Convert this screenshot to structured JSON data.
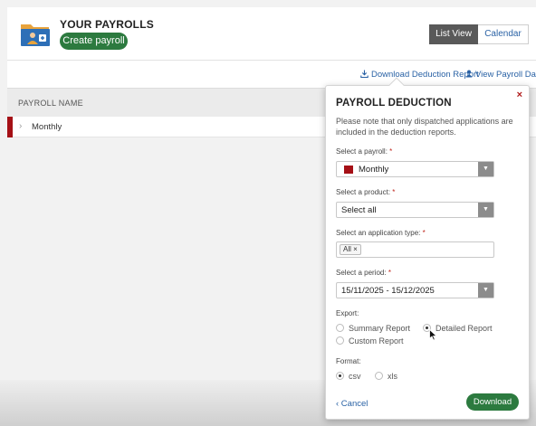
{
  "header": {
    "title": "YOUR PAYROLLS",
    "create_label": "Create payroll",
    "view_toggle": {
      "list": "List View",
      "calendar": "Calendar",
      "active": "List View"
    }
  },
  "links": {
    "download": "Download Deduction Report",
    "view_data": "View Payroll Data"
  },
  "table": {
    "column_header": "PAYROLL NAME",
    "rows": [
      {
        "chevron": "›",
        "name": "Monthly"
      }
    ]
  },
  "panel": {
    "close": "×",
    "title": "PAYROLL DEDUCTION",
    "note": "Please note that only dispatched applications are included in the deduction reports.",
    "required_mark": "*",
    "payroll": {
      "label": "Select a payroll:",
      "value": "Monthly",
      "swatch_color": "#a51016"
    },
    "product": {
      "label": "Select a product:",
      "value": "Select all"
    },
    "application_type": {
      "label": "Select an application type:",
      "tag": "All ×"
    },
    "period": {
      "label": "Select a period:",
      "value": "15/11/2025 - 15/12/2025"
    },
    "export": {
      "label": "Export:",
      "options": [
        {
          "label": "Summary Report",
          "selected": false
        },
        {
          "label": "Detailed Report",
          "selected": true
        },
        {
          "label": "Custom Report",
          "selected": false
        }
      ]
    },
    "format": {
      "label": "Format:",
      "options": [
        {
          "label": "csv",
          "selected": true
        },
        {
          "label": "xls",
          "selected": false
        }
      ]
    },
    "cancel_label": "‹ Cancel",
    "download_label": "Download"
  },
  "colors": {
    "brand_green": "#2c7a3f",
    "link_blue": "#2a62a5",
    "accent_red": "#a51016"
  }
}
